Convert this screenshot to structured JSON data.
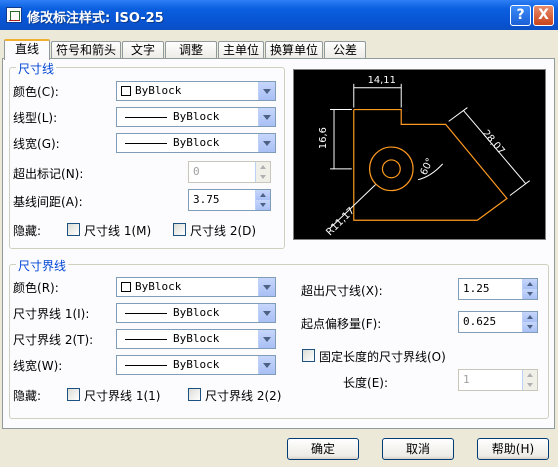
{
  "window": {
    "title": "修改标注样式: ISO-25",
    "help_glyph": "?",
    "close_glyph": "X"
  },
  "tabs": [
    "直线",
    "符号和箭头",
    "文字",
    "调整",
    "主单位",
    "换算单位",
    "公差"
  ],
  "dim_lines": {
    "title": "尺寸线",
    "color_label": "颜色",
    "color_key": "(C):",
    "color_value": "ByBlock",
    "linetype_label": "线型",
    "linetype_key": "(L):",
    "linetype_value": "ByBlock",
    "lineweight_label": "线宽",
    "lineweight_key": "(G):",
    "lineweight_value": "ByBlock",
    "extend_label": "超出标记",
    "extend_key": "(N):",
    "extend_value": "0",
    "baseline_label": "基线间距",
    "baseline_key": "(A):",
    "baseline_value": "3.75",
    "suppress_label": "隐藏:",
    "suppress_1": "尺寸线 1(M)",
    "suppress_2": "尺寸线 2(D)"
  },
  "ext_lines": {
    "title": "尺寸界线",
    "color_label": "颜色",
    "color_key": "(R):",
    "color_value": "ByBlock",
    "lt1_label": "尺寸界线 1",
    "lt1_key": "(I):",
    "lt1_value": "ByBlock",
    "lt2_label": "尺寸界线 2",
    "lt2_key": "(T):",
    "lt2_value": "ByBlock",
    "lw_label": "线宽",
    "lw_key": "(W):",
    "lw_value": "ByBlock",
    "suppress_label": "隐藏:",
    "suppress_1": "尺寸界线 1(1)",
    "suppress_2": "尺寸界线 2(2)",
    "beyond_label": "超出尺寸线",
    "beyond_key": "(X):",
    "beyond_value": "1.25",
    "offset_label": "起点偏移量",
    "offset_key": "(F):",
    "offset_value": "0.625",
    "fixed_label": "固定长度的尺寸界线(O)",
    "length_label": "长度",
    "length_key": "(E):",
    "length_value": "1"
  },
  "preview": {
    "dim_top": "14,11",
    "dim_left": "16,6",
    "dim_right": "28,07",
    "dim_angle": "60°",
    "dim_radius": "R11,17"
  },
  "buttons": {
    "ok": "确定",
    "cancel": "取消",
    "help": "帮助(H)"
  },
  "colors": {
    "title_bar": "#0a5fe0",
    "group_title": "#0046d5",
    "preview_bg": "#000000",
    "geometry": "#ff9a20",
    "dims": "#ffffff"
  }
}
